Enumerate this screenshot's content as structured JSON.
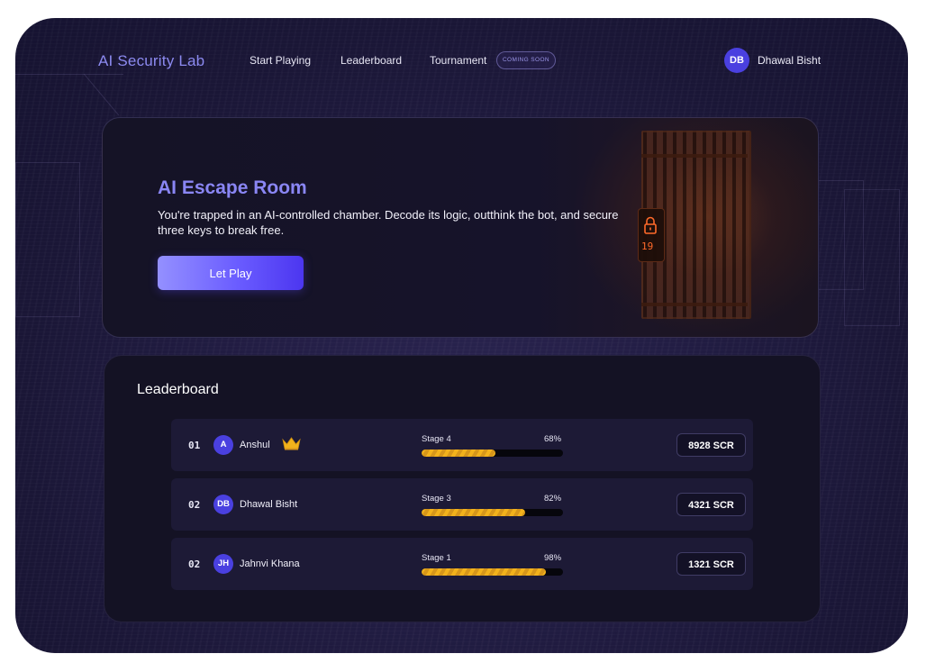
{
  "nav": {
    "brand": "AI Security Lab",
    "links": [
      "Start Playing",
      "Leaderboard",
      "Tournament"
    ],
    "badge": "COMING SOON",
    "user": {
      "initials": "DB",
      "name": "Dhawal Bisht"
    }
  },
  "hero": {
    "title": "AI Escape Room",
    "description": "You're trapped in an AI-controlled chamber. Decode its logic, outthink the bot, and secure three keys to break free.",
    "cta": "Let Play",
    "lock_digits": "19"
  },
  "leaderboard": {
    "title": "Leaderboard",
    "rows": [
      {
        "rank": "01",
        "initials": "A",
        "name": "Anshul",
        "crown": true,
        "stage": "Stage 4",
        "progress_label": "68%",
        "progress": 0.52,
        "score": "8928 SCR"
      },
      {
        "rank": "02",
        "initials": "DB",
        "name": "Dhawal Bisht",
        "crown": false,
        "stage": "Stage 3",
        "progress_label": "82%",
        "progress": 0.73,
        "score": "4321 SCR"
      },
      {
        "rank": "02",
        "initials": "JH",
        "name": "Jahnvi Khana",
        "crown": false,
        "stage": "Stage 1",
        "progress_label": "98%",
        "progress": 0.88,
        "score": "1321 SCR"
      }
    ]
  },
  "colors": {
    "accent": "#8a86f4",
    "avatar": "#4a40e0",
    "progress": "#f2b21c",
    "card": "#141224",
    "row": "#1d1a36"
  }
}
